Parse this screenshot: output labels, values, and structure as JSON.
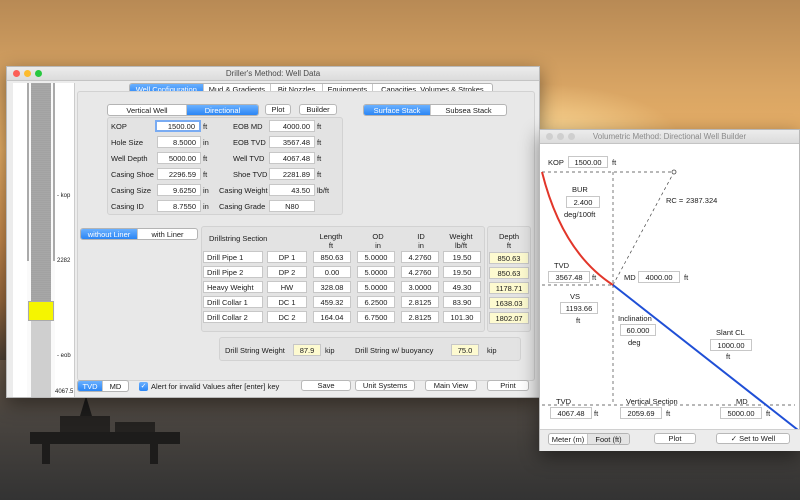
{
  "main_window": {
    "title": "Driller's Method: Well Data",
    "tabs": [
      "Well Configuration",
      "Mud & Gradients",
      "Bit Nozzles",
      "Equipments",
      "Capacities, Volumes & Strokes"
    ],
    "well_type": [
      "Vertical Well",
      "Directional"
    ],
    "plot_label": "Plot",
    "builder_label": "Builder",
    "stack_type": [
      "Surface Stack",
      "Subsea Stack"
    ],
    "well_fields_left": [
      {
        "label": "KOP",
        "value": "1500.00",
        "unit": "ft"
      },
      {
        "label": "Hole Size",
        "value": "8.5000",
        "unit": "in"
      },
      {
        "label": "Well Depth",
        "value": "5000.00",
        "unit": "ft"
      },
      {
        "label": "Casing Shoe",
        "value": "2296.59",
        "unit": "ft"
      },
      {
        "label": "Casing Size",
        "value": "9.6250",
        "unit": "in"
      },
      {
        "label": "Casing ID",
        "value": "8.7550",
        "unit": "in"
      }
    ],
    "well_fields_right": [
      {
        "label": "EOB MD",
        "value": "4000.00",
        "unit": "ft"
      },
      {
        "label": "EOB TVD",
        "value": "3567.48",
        "unit": "ft"
      },
      {
        "label": "Well TVD",
        "value": "4067.48",
        "unit": "ft"
      },
      {
        "label": "Shoe TVD",
        "value": "2281.89",
        "unit": "ft"
      },
      {
        "label": "Casing Weight",
        "value": "43.50",
        "unit": "lb/ft"
      },
      {
        "label": "Casing Grade",
        "value": "N80",
        "unit": ""
      }
    ],
    "liner_toggle": [
      "without Liner",
      "with Liner"
    ],
    "drillstring_headers": {
      "section": "Drillstring Section",
      "length": "Length",
      "length_unit": "ft",
      "od": "OD",
      "od_unit": "in",
      "id": "ID",
      "id_unit": "in",
      "weight": "Weight",
      "weight_unit": "lb/ft",
      "depth": "Depth",
      "depth_unit": "ft"
    },
    "drillstring_rows": [
      {
        "name": "Drill Pipe 1",
        "code": "DP 1",
        "length": "850.63",
        "od": "5.0000",
        "id": "4.2760",
        "weight": "19.50",
        "depth": "850.63"
      },
      {
        "name": "Drill Pipe 2",
        "code": "DP 2",
        "length": "0.00",
        "od": "5.0000",
        "id": "4.2760",
        "weight": "19.50",
        "depth": "850.63"
      },
      {
        "name": "Heavy Weight",
        "code": "HW",
        "length": "328.08",
        "od": "5.0000",
        "id": "3.0000",
        "weight": "49.30",
        "depth": "1178.71"
      },
      {
        "name": "Drill Collar 1",
        "code": "DC 1",
        "length": "459.32",
        "od": "6.2500",
        "id": "2.8125",
        "weight": "83.90",
        "depth": "1638.03"
      },
      {
        "name": "Drill Collar 2",
        "code": "DC 2",
        "length": "164.04",
        "od": "6.7500",
        "id": "2.8125",
        "weight": "101.30",
        "depth": "1802.07"
      }
    ],
    "string_weight": {
      "label": "Drill String Weight",
      "value": "87.9",
      "unit": "kip"
    },
    "buoyancy_weight": {
      "label": "Drill String w/ buoyancy",
      "value": "75.0",
      "unit": "kip"
    },
    "depth_mode": [
      "TVD",
      "MD"
    ],
    "alert_label": "Alert for invalid Values after [enter] key",
    "save_label": "Save",
    "unit_systems_label": "Unit Systems",
    "main_view_label": "Main View",
    "print_label": "Print",
    "wellbore": {
      "kop": "- kop",
      "depth_2282": "2282",
      "eob": "- eob",
      "bottom": "4067.5"
    }
  },
  "builder_window": {
    "title": "Volumetric Method: Directional Well Builder",
    "kop": {
      "label": "KOP",
      "value": "1500.00",
      "unit": "ft"
    },
    "bur": {
      "label": "BUR",
      "value": "2.400",
      "unit": "deg/100ft"
    },
    "rc": {
      "label": "RC =",
      "value": "2387.324"
    },
    "tvd_eob": {
      "label": "TVD",
      "value": "3567.48",
      "unit": "ft"
    },
    "md_eob": {
      "label": "MD",
      "value": "4000.00",
      "unit": "ft"
    },
    "vs": {
      "label": "VS",
      "value": "1193.66",
      "unit": "ft"
    },
    "inclination": {
      "label": "Inclination",
      "value": "60.000",
      "unit": "deg"
    },
    "slant": {
      "label": "Slant CL",
      "value": "1000.00",
      "unit": "ft"
    },
    "tvd_total": {
      "label": "TVD",
      "value": "4067.48",
      "unit": "ft"
    },
    "vertical_section": {
      "label": "Vertical Section",
      "value": "2059.69",
      "unit": "ft"
    },
    "md_total": {
      "label": "MD",
      "value": "5000.00",
      "unit": "ft"
    },
    "units": [
      "Meter (m)",
      "Foot (ft)"
    ],
    "plot_label": "Plot",
    "set_label": "Set to Well",
    "colors": {
      "build": "#e2362a",
      "slant": "#1f4fd6"
    }
  }
}
